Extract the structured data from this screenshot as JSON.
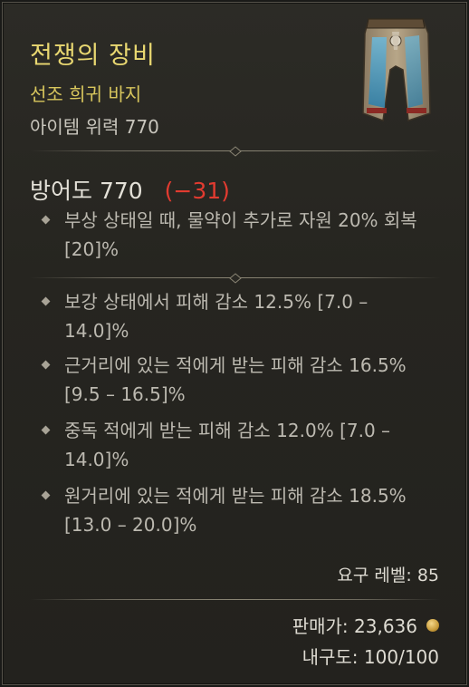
{
  "item": {
    "name": "전쟁의 장비",
    "type": "선조 희귀 바지",
    "power": "아이템 위력 770"
  },
  "armor": {
    "label": "방어도 770",
    "diff": "(−31)"
  },
  "implicit_affixes": [
    {
      "text": "부상 상태일 때, 물약이 추가로 자원 20% 회복 [20]%"
    }
  ],
  "affixes": [
    {
      "text": "보강 상태에서 피해 감소 12.5% [7.0 – 14.0]%"
    },
    {
      "text": "근거리에 있는 적에게 받는 피해 감소 16.5% [9.5 – 16.5]%"
    },
    {
      "text": "중독 적에게 받는 피해 감소 12.0% [7.0 – 14.0]%"
    },
    {
      "text": "원거리에 있는 적에게 받는 피해 감소 18.5% [13.0 – 20.0]%"
    }
  ],
  "requirements": {
    "level": "요구 레벨: 85"
  },
  "footer": {
    "sell_value": "판매가: 23,636",
    "durability": "내구도: 100/100"
  },
  "colors": {
    "name": "#e9d871",
    "rarity": "#d8c65d",
    "negative": "#e23b30",
    "text": "#bcb9b0"
  },
  "icons": {
    "bullet": "diamond-bullet-icon",
    "gold": "gold-coin-icon"
  }
}
